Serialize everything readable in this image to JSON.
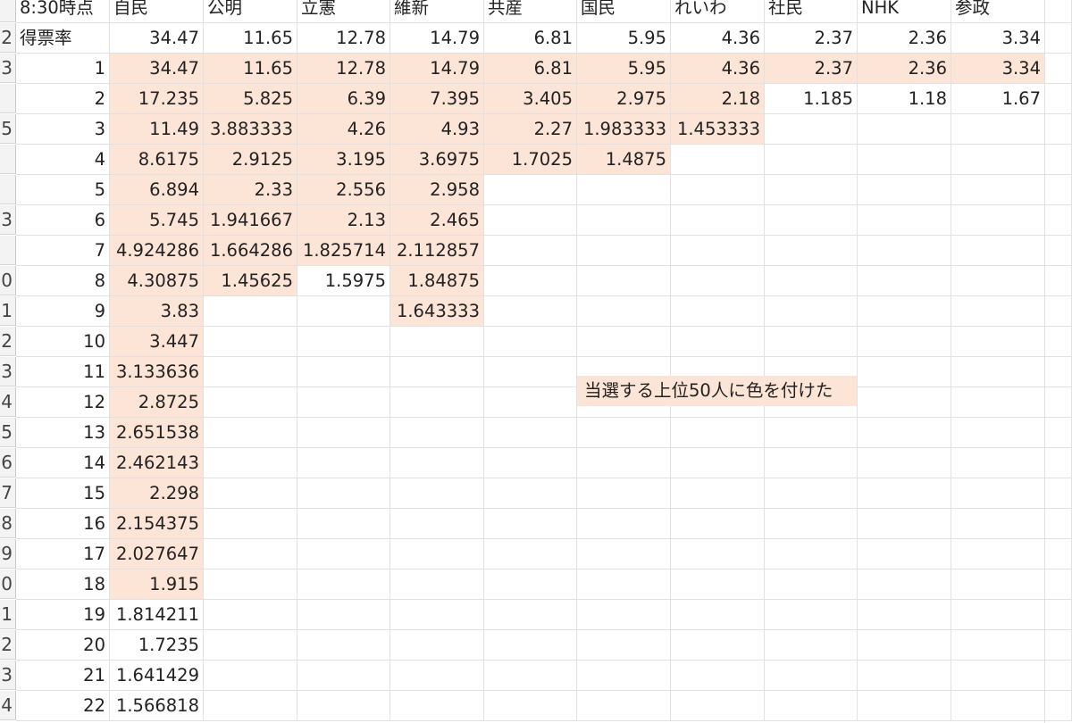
{
  "sheet": {
    "row_numbers": [
      "",
      "2",
      "3",
      "",
      "5",
      "",
      "",
      "3",
      "",
      "0",
      "1",
      "2",
      "3",
      "4",
      "5",
      "6",
      "7",
      "8",
      "9",
      "0",
      "1",
      "2",
      "3",
      "4"
    ],
    "header_row": [
      "8:30時点",
      "自民",
      "公明",
      "立憲",
      "維新",
      "共産",
      "国民",
      "れいわ",
      "社民",
      "NHK",
      "参政"
    ],
    "vote_rate_label": "得票率",
    "vote_rates": [
      "34.47",
      "11.65",
      "12.78",
      "14.79",
      "6.81",
      "5.95",
      "4.36",
      "2.37",
      "2.36",
      "3.34"
    ],
    "divisor_rows": [
      {
        "n": "1",
        "cells": [
          "34.47",
          "11.65",
          "12.78",
          "14.79",
          "6.81",
          "5.95",
          "4.36",
          "2.37",
          "2.36",
          "3.34"
        ]
      },
      {
        "n": "2",
        "cells": [
          "17.235",
          "5.825",
          "6.39",
          "7.395",
          "3.405",
          "2.975",
          "2.18",
          "1.185",
          "1.18",
          "1.67"
        ]
      },
      {
        "n": "3",
        "cells": [
          "11.49",
          "3.883333",
          "4.26",
          "4.93",
          "2.27",
          "1.983333",
          "1.453333",
          "",
          "",
          ""
        ]
      },
      {
        "n": "4",
        "cells": [
          "8.6175",
          "2.9125",
          "3.195",
          "3.6975",
          "1.7025",
          "1.4875",
          "",
          "",
          "",
          ""
        ]
      },
      {
        "n": "5",
        "cells": [
          "6.894",
          "2.33",
          "2.556",
          "2.958",
          "",
          "",
          "",
          "",
          "",
          ""
        ]
      },
      {
        "n": "6",
        "cells": [
          "5.745",
          "1.941667",
          "2.13",
          "2.465",
          "",
          "",
          "",
          "",
          "",
          ""
        ]
      },
      {
        "n": "7",
        "cells": [
          "4.924286",
          "1.664286",
          "1.825714",
          "2.112857",
          "",
          "",
          "",
          "",
          "",
          ""
        ]
      },
      {
        "n": "8",
        "cells": [
          "4.30875",
          "1.45625",
          "1.5975",
          "1.84875",
          "",
          "",
          "",
          "",
          "",
          ""
        ]
      },
      {
        "n": "9",
        "cells": [
          "3.83",
          "",
          "",
          "1.643333",
          "",
          "",
          "",
          "",
          "",
          ""
        ]
      },
      {
        "n": "10",
        "cells": [
          "3.447",
          "",
          "",
          "",
          "",
          "",
          "",
          "",
          "",
          ""
        ]
      },
      {
        "n": "11",
        "cells": [
          "3.133636",
          "",
          "",
          "",
          "",
          "",
          "",
          "",
          "",
          ""
        ]
      },
      {
        "n": "12",
        "cells": [
          "2.8725",
          "",
          "",
          "",
          "",
          "",
          "",
          "",
          "",
          ""
        ]
      },
      {
        "n": "13",
        "cells": [
          "2.651538",
          "",
          "",
          "",
          "",
          "",
          "",
          "",
          "",
          ""
        ]
      },
      {
        "n": "14",
        "cells": [
          "2.462143",
          "",
          "",
          "",
          "",
          "",
          "",
          "",
          "",
          ""
        ]
      },
      {
        "n": "15",
        "cells": [
          "2.298",
          "",
          "",
          "",
          "",
          "",
          "",
          "",
          "",
          ""
        ]
      },
      {
        "n": "16",
        "cells": [
          "2.154375",
          "",
          "",
          "",
          "",
          "",
          "",
          "",
          "",
          ""
        ]
      },
      {
        "n": "17",
        "cells": [
          "2.027647",
          "",
          "",
          "",
          "",
          "",
          "",
          "",
          "",
          ""
        ]
      },
      {
        "n": "18",
        "cells": [
          "1.915",
          "",
          "",
          "",
          "",
          "",
          "",
          "",
          "",
          ""
        ]
      },
      {
        "n": "19",
        "cells": [
          "1.814211",
          "",
          "",
          "",
          "",
          "",
          "",
          "",
          "",
          ""
        ]
      },
      {
        "n": "20",
        "cells": [
          "1.7235",
          "",
          "",
          "",
          "",
          "",
          "",
          "",
          "",
          ""
        ]
      },
      {
        "n": "21",
        "cells": [
          "1.641429",
          "",
          "",
          "",
          "",
          "",
          "",
          "",
          "",
          ""
        ]
      },
      {
        "n": "22",
        "cells": [
          "1.566818",
          "",
          "",
          "",
          "",
          "",
          "",
          "",
          "",
          ""
        ]
      }
    ],
    "highlight_counts": [
      18,
      8,
      7,
      9,
      4,
      4,
      3,
      1,
      1,
      1
    ],
    "note": "当選する上位50人に色を付けた",
    "highlight_color": "#fce4d6",
    "gridline_color": "#e1e1e1"
  }
}
